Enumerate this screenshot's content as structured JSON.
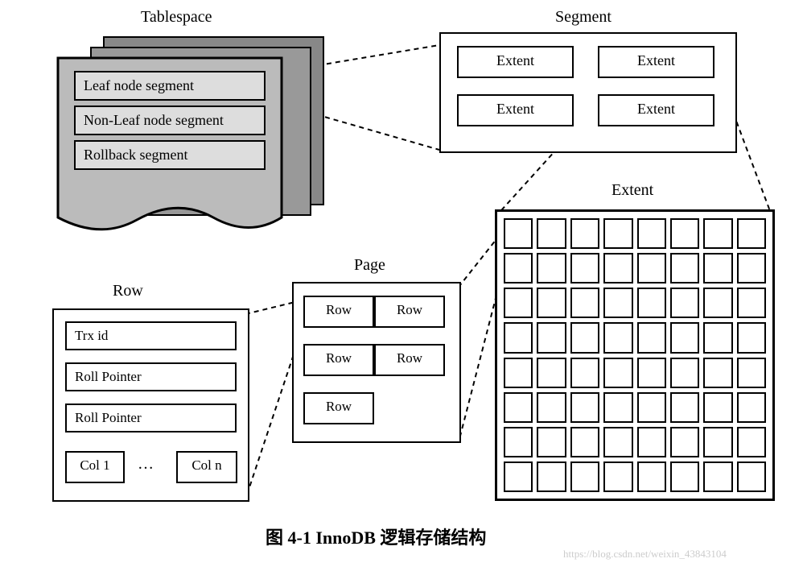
{
  "tablespace": {
    "title": "Tablespace",
    "rows": [
      "Leaf node segment",
      "Non-Leaf node segment",
      "Rollback segment"
    ]
  },
  "segment": {
    "title": "Segment",
    "extents": [
      "Extent",
      "Extent",
      "Extent",
      "Extent"
    ]
  },
  "extent": {
    "title": "Extent",
    "grid_rows": 8,
    "grid_cols": 8
  },
  "page": {
    "title": "Page",
    "rows": [
      "Row",
      "Row",
      "Row",
      "Row",
      "Row"
    ]
  },
  "row": {
    "title": "Row",
    "fields": [
      "Trx id",
      "Roll Pointer",
      "Roll Pointer"
    ],
    "cols": {
      "first": "Col 1",
      "ellipsis": "…",
      "last": "Col n"
    }
  },
  "caption": "图 4-1   InnoDB 逻辑存储结构",
  "watermark": "https://blog.csdn.net/weixin_43843104"
}
